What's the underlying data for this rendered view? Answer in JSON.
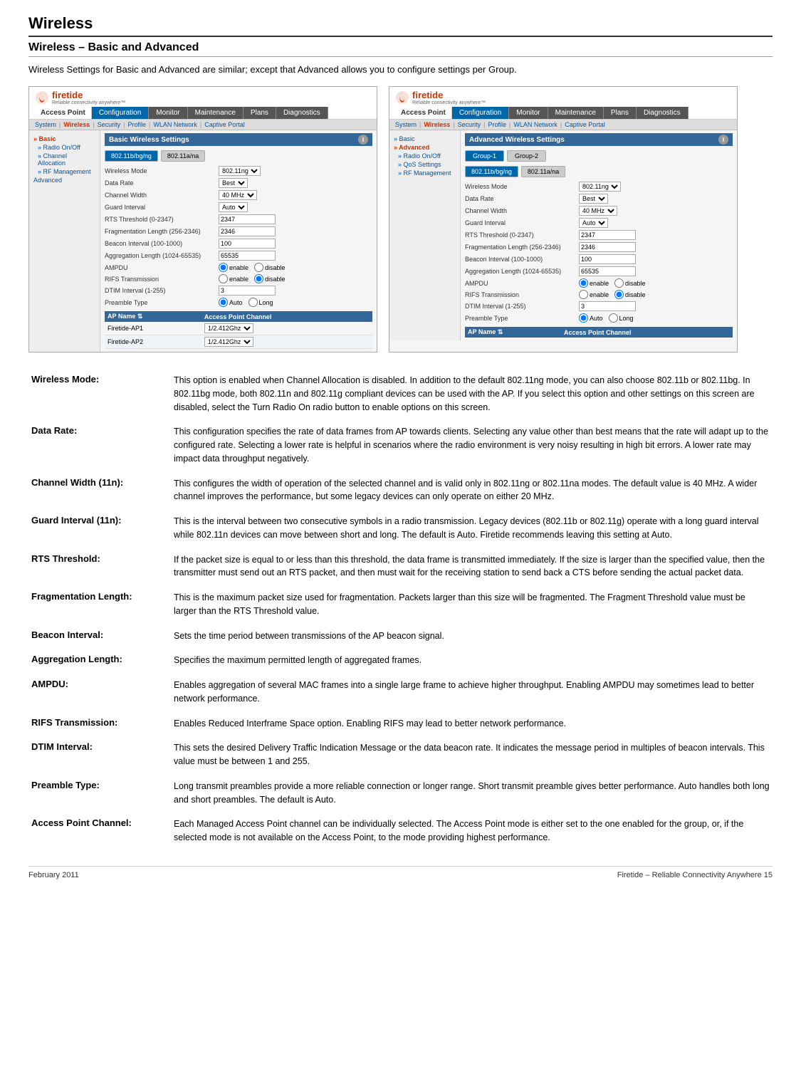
{
  "page": {
    "title": "Wireless",
    "section": "Wireless – Basic and Advanced",
    "intro": "Wireless Settings for Basic and Advanced are similar; except that Advanced allows you to configure settings per Group."
  },
  "footer": {
    "left": "February 2011",
    "right": "Firetide – Reliable Connectivity Anywhere 15"
  },
  "basic_screenshot": {
    "logo_text": "firetide",
    "tagline": "Reliable connectivity anywhere™",
    "ap_label": "Access Point",
    "nav_tabs": [
      "Configuration",
      "Monitor",
      "Maintenance",
      "Plans",
      "Diagnostics"
    ],
    "active_nav": "Configuration",
    "sys_nav": [
      "System",
      "Wireless",
      "Security",
      "Profile",
      "WLAN Network",
      "Captive Portal"
    ],
    "sidebar_items": [
      {
        "label": "» Basic",
        "active": true
      },
      {
        "label": "» Radio On/Off",
        "sub": true
      },
      {
        "label": "» Channel Allocation",
        "sub": true
      },
      {
        "label": "» RF Management",
        "sub": true
      },
      {
        "label": "Advanced",
        "sub": false
      }
    ],
    "content_title": "Basic Wireless Settings",
    "radio_tabs": [
      "802.11b/bg/ng",
      "802.11a/na"
    ],
    "active_radio_tab": "802.11b/bg/ng",
    "form_rows": [
      {
        "label": "Wireless Mode",
        "value": "802.11ng",
        "type": "select"
      },
      {
        "label": "Data Rate",
        "value": "Best",
        "type": "select"
      },
      {
        "label": "Channel Width",
        "value": "40 MHz",
        "type": "select"
      },
      {
        "label": "Guard Interval",
        "value": "Auto",
        "type": "select"
      },
      {
        "label": "RTS Threshold (0-2347)",
        "value": "2347",
        "type": "input"
      },
      {
        "label": "Fragmentation Length (256-2346)",
        "value": "2346",
        "type": "input"
      },
      {
        "label": "Beacon Interval (100-1000)",
        "value": "100",
        "type": "input"
      },
      {
        "label": "Aggregation Length (1024-65535)",
        "value": "65535",
        "type": "input"
      },
      {
        "label": "AMPDU",
        "value": "enable",
        "type": "radio",
        "options": [
          "enable",
          "disable"
        ]
      },
      {
        "label": "RIFS Transmission",
        "value": "disable",
        "type": "radio",
        "options": [
          "enable",
          "disable"
        ]
      },
      {
        "label": "DTIM Interval (1-255)",
        "value": "3",
        "type": "input"
      },
      {
        "label": "Preamble Type",
        "value": "Auto",
        "type": "radio",
        "options": [
          "Auto",
          "Long"
        ]
      }
    ],
    "ap_table": {
      "headers": [
        "AP Name",
        "Access Point Channel"
      ],
      "rows": [
        [
          "Firetide-AP1",
          "1/2.412Ghz"
        ],
        [
          "Firetide-AP2",
          "1/2.412Ghz"
        ]
      ]
    }
  },
  "advanced_screenshot": {
    "logo_text": "firetide",
    "tagline": "Reliable connectivity anywhere™",
    "ap_label": "Access Point",
    "nav_tabs": [
      "Configuration",
      "Monitor",
      "Maintenance",
      "Plans",
      "Diagnostics"
    ],
    "active_nav": "Configuration",
    "sys_nav": [
      "System",
      "Wireless",
      "Security",
      "Profile",
      "WLAN Network",
      "Captive Portal"
    ],
    "sidebar_items": [
      {
        "label": "» Basic",
        "active": false
      },
      {
        "label": "» Advanced",
        "active": true
      },
      {
        "label": "» Radio On/Off",
        "sub": true
      },
      {
        "label": "» QoS Settings",
        "sub": true
      },
      {
        "label": "» RF Management",
        "sub": true
      }
    ],
    "content_title": "Advanced Wireless Settings",
    "group_tabs": [
      "Group-1",
      "Group-2"
    ],
    "active_group_tab": "Group-1",
    "radio_tabs": [
      "802.11b/bg/ng",
      "802.11a/na"
    ],
    "active_radio_tab": "802.11b/bg/ng",
    "form_rows": [
      {
        "label": "Wireless Mode",
        "value": "802.11ng",
        "type": "select"
      },
      {
        "label": "Data Rate",
        "value": "Best",
        "type": "select"
      },
      {
        "label": "Channel Width",
        "value": "40 MHz",
        "type": "select"
      },
      {
        "label": "Guard Interval",
        "value": "Auto",
        "type": "select"
      },
      {
        "label": "RTS Threshold (0-2347)",
        "value": "2347",
        "type": "input"
      },
      {
        "label": "Fragmentation Length (256-2346)",
        "value": "2346",
        "type": "input"
      },
      {
        "label": "Beacon Interval (100-1000)",
        "value": "100",
        "type": "input"
      },
      {
        "label": "Aggregation Length (1024-65535)",
        "value": "65535",
        "type": "input"
      },
      {
        "label": "AMPDU",
        "value": "enable",
        "type": "radio",
        "options": [
          "enable",
          "disable"
        ]
      },
      {
        "label": "RIFS Transmission",
        "value": "disable",
        "type": "radio",
        "options": [
          "enable",
          "disable"
        ]
      },
      {
        "label": "DTIM Interval (1-255)",
        "value": "3",
        "type": "input"
      },
      {
        "label": "Preamble Type",
        "value": "Auto",
        "type": "radio",
        "options": [
          "Auto",
          "Long"
        ]
      }
    ],
    "ap_table": {
      "headers": [
        "AP Name",
        "Access Point Channel"
      ],
      "rows": []
    }
  },
  "descriptions": [
    {
      "term": "Wireless Mode:",
      "def": "This option is enabled when Channel Allocation is disabled. In addition to the default 802.11ng mode, you can also choose 802.11b or 802.11bg. In 802.11bg mode, both 802.11n and 802.11g compliant devices can be used with the AP. If you select this option and other settings on this screen are disabled, select the Turn Radio On radio button to enable options on this screen."
    },
    {
      "term": "Data Rate:",
      "def": "This configuration specifies the rate of data frames from AP towards clients. Selecting any value other than best means that the rate will adapt up to the configured rate. Selecting a lower rate is helpful in scenarios where the radio environment is very noisy resulting in high bit errors. A lower rate may impact data throughput negatively."
    },
    {
      "term": "Channel Width (11n):",
      "def": "This configures the width of operation of the selected channel and is valid only in 802.11ng or 802.11na modes. The default value is 40 MHz. A wider channel improves the performance, but some legacy devices can only operate on either 20 MHz."
    },
    {
      "term": "Guard Interval (11n):",
      "def": "This is the interval between two consecutive symbols in a radio transmission. Legacy devices (802.11b or 802.11g) operate with a long guard interval while 802.11n devices can move between short and long. The default is Auto. Firetide recommends leaving this setting at Auto."
    },
    {
      "term": "RTS Threshold:",
      "def": "If the packet size is equal to or less than this threshold, the data frame is transmitted immediately. If the size is larger than the specified value, then the transmitter must send out an RTS packet, and then must wait for the receiving station to send back a CTS before sending the actual packet data."
    },
    {
      "term": "Fragmentation Length:",
      "def": "This is the maximum packet size used for fragmentation. Packets larger than this size will be fragmented. The Fragment Threshold value must be larger than the RTS Threshold value."
    },
    {
      "term": "Beacon Interval:",
      "def": "Sets the time period between transmissions of the AP beacon signal."
    },
    {
      "term": "Aggregation Length:",
      "def": "Specifies the maximum permitted length of aggregated frames."
    },
    {
      "term": "AMPDU:",
      "def": "Enables aggregation of several MAC frames into a single large frame to achieve higher throughput. Enabling AMPDU may sometimes lead to better network performance."
    },
    {
      "term": "RIFS Transmission:",
      "def": "Enables Reduced Interframe Space option. Enabling RIFS may lead to better network performance."
    },
    {
      "term": "DTIM Interval:",
      "def": "This sets the desired Delivery Traffic Indication Message or the data beacon rate. It indicates the message period in multiples of beacon intervals. This value must be between 1 and 255."
    },
    {
      "term": "Preamble Type:",
      "def": "Long transmit preambles provide a more reliable connection or longer range. Short transmit preamble gives better performance. Auto handles both long and short preambles. The default is Auto."
    },
    {
      "term": "Access Point Channel:",
      "def": "Each Managed Access Point channel can be individually selected. The Access Point mode is either set to the one enabled for the group, or, if the selected mode is not available on the Access Point, to the mode providing highest performance."
    }
  ]
}
